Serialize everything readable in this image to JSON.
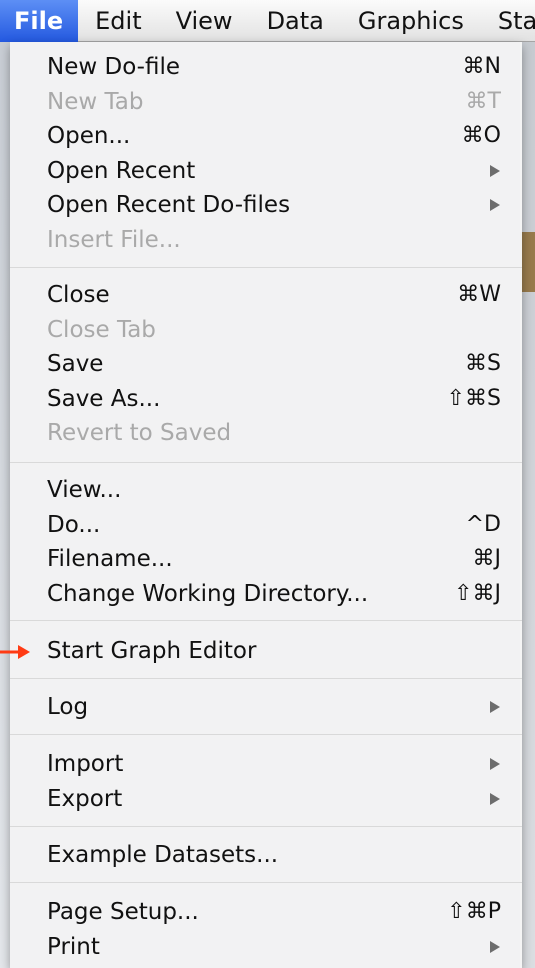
{
  "menubar": {
    "items": [
      "File",
      "Edit",
      "View",
      "Data",
      "Graphics",
      "Sta"
    ]
  },
  "file_menu": {
    "groups": [
      [
        {
          "label": "New Do-file",
          "shortcut": "⌘N",
          "enabled": true
        },
        {
          "label": "New Tab",
          "shortcut": "⌘T",
          "enabled": false
        },
        {
          "label": "Open...",
          "shortcut": "⌘O",
          "enabled": true
        },
        {
          "label": "Open Recent",
          "submenu": true,
          "enabled": true
        },
        {
          "label": "Open Recent Do-files",
          "submenu": true,
          "enabled": true
        },
        {
          "label": "Insert File...",
          "enabled": false
        }
      ],
      [
        {
          "label": "Close",
          "shortcut": "⌘W",
          "enabled": true
        },
        {
          "label": "Close Tab",
          "enabled": false
        },
        {
          "label": "Save",
          "shortcut": "⌘S",
          "enabled": true
        },
        {
          "label": "Save As...",
          "shortcut": "⇧⌘S",
          "enabled": true
        },
        {
          "label": "Revert to Saved",
          "enabled": false
        }
      ],
      [
        {
          "label": "View...",
          "enabled": true
        },
        {
          "label": "Do...",
          "shortcut": "^D",
          "enabled": true
        },
        {
          "label": "Filename...",
          "shortcut": "⌘J",
          "enabled": true
        },
        {
          "label": "Change Working Directory...",
          "shortcut": "⇧⌘J",
          "enabled": true
        }
      ],
      [
        {
          "label": "Start Graph Editor",
          "enabled": true,
          "highlighted_by_arrow": true
        }
      ],
      [
        {
          "label": "Log",
          "submenu": true,
          "enabled": true
        }
      ],
      [
        {
          "label": "Import",
          "submenu": true,
          "enabled": true
        },
        {
          "label": "Export",
          "submenu": true,
          "enabled": true
        }
      ],
      [
        {
          "label": "Example Datasets...",
          "enabled": true
        }
      ],
      [
        {
          "label": "Page Setup...",
          "shortcut": "⇧⌘P",
          "enabled": true
        },
        {
          "label": "Print",
          "submenu": true,
          "enabled": true
        }
      ]
    ]
  },
  "colors": {
    "active_menu": "#2f66e6",
    "disabled_text": "#a9a9a9",
    "annotation_arrow": "#ff3b14"
  }
}
